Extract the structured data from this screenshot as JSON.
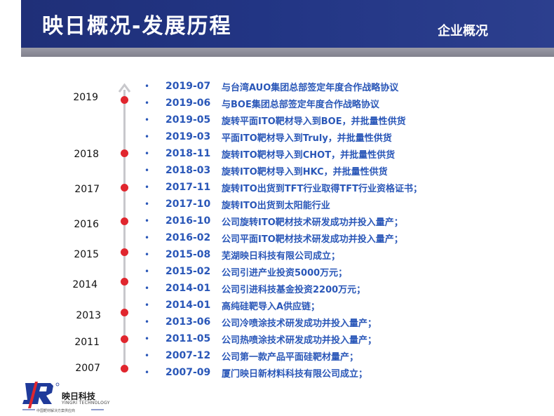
{
  "header": {
    "title": "映日概况-发展历程",
    "section": "企业概况"
  },
  "years": [
    "2019",
    "2018",
    "2017",
    "2016",
    "2015",
    "2014",
    "2013",
    "2011",
    "2007"
  ],
  "timeline": [
    {
      "date": "2019-07",
      "text": "与台湾AUO集团总部签定年度合作战略协议"
    },
    {
      "date": "2019-06",
      "text": "与BOE集团总部签定年度合作战略协议"
    },
    {
      "date": "2019-05",
      "text": "旋转平面ITO靶材导入到BOE，并批量性供货"
    },
    {
      "date": "2019-03",
      "text": "平面ITO靶材导入到Truly，并批量性供货"
    },
    {
      "date": "2018-11",
      "text": "旋转ITO靶材导入到CHOT，并批量性供货"
    },
    {
      "date": "2018-03",
      "text": "旋转ITO靶材导入到HKC，并批量性供货"
    },
    {
      "date": "2017-11",
      "text": "旋转ITO出货到TFT行业取得TFT行业资格证书；"
    },
    {
      "date": "2017-10",
      "text": "旋转ITO出货到太阳能行业"
    },
    {
      "date": "2016-10",
      "text": "公司旋转ITO靶材技术研发成功并投入量产；"
    },
    {
      "date": "2016-02",
      "text": "公司平面ITO靶材技术研发成功并投入量产；"
    },
    {
      "date": "2015-08",
      "text": "芜湖映日科技有限公司成立；"
    },
    {
      "date": "2015-02",
      "text": "公司引进产业投资5000万元；"
    },
    {
      "date": "2014-01",
      "text": "公司引进科技基金投资2200万元；"
    },
    {
      "date": "2014-01",
      "text": "高纯硅靶导入A供应链；"
    },
    {
      "date": "2013-06",
      "text": "公司冷喷涂技术研发成功并投入量产；"
    },
    {
      "date": "2011-05",
      "text": "公司热喷涂技术研发成功并投入量产；"
    },
    {
      "date": "2007-12",
      "text": "公司第一款产品平面硅靶材量产；"
    },
    {
      "date": "2007-09",
      "text": "厦门映日新材料科技有限公司成立；"
    }
  ],
  "logo": {
    "name": "映日科技",
    "english": "YINGRI TECHNOLOGY",
    "slogan": "中国靶材解决方案供应商",
    "brand_color": "#1f3a9a",
    "accent_color": "#e0262e"
  },
  "colors": {
    "header_bg": "#223584",
    "accent_red": "#e0262e",
    "text_blue": "#2a57b8"
  }
}
